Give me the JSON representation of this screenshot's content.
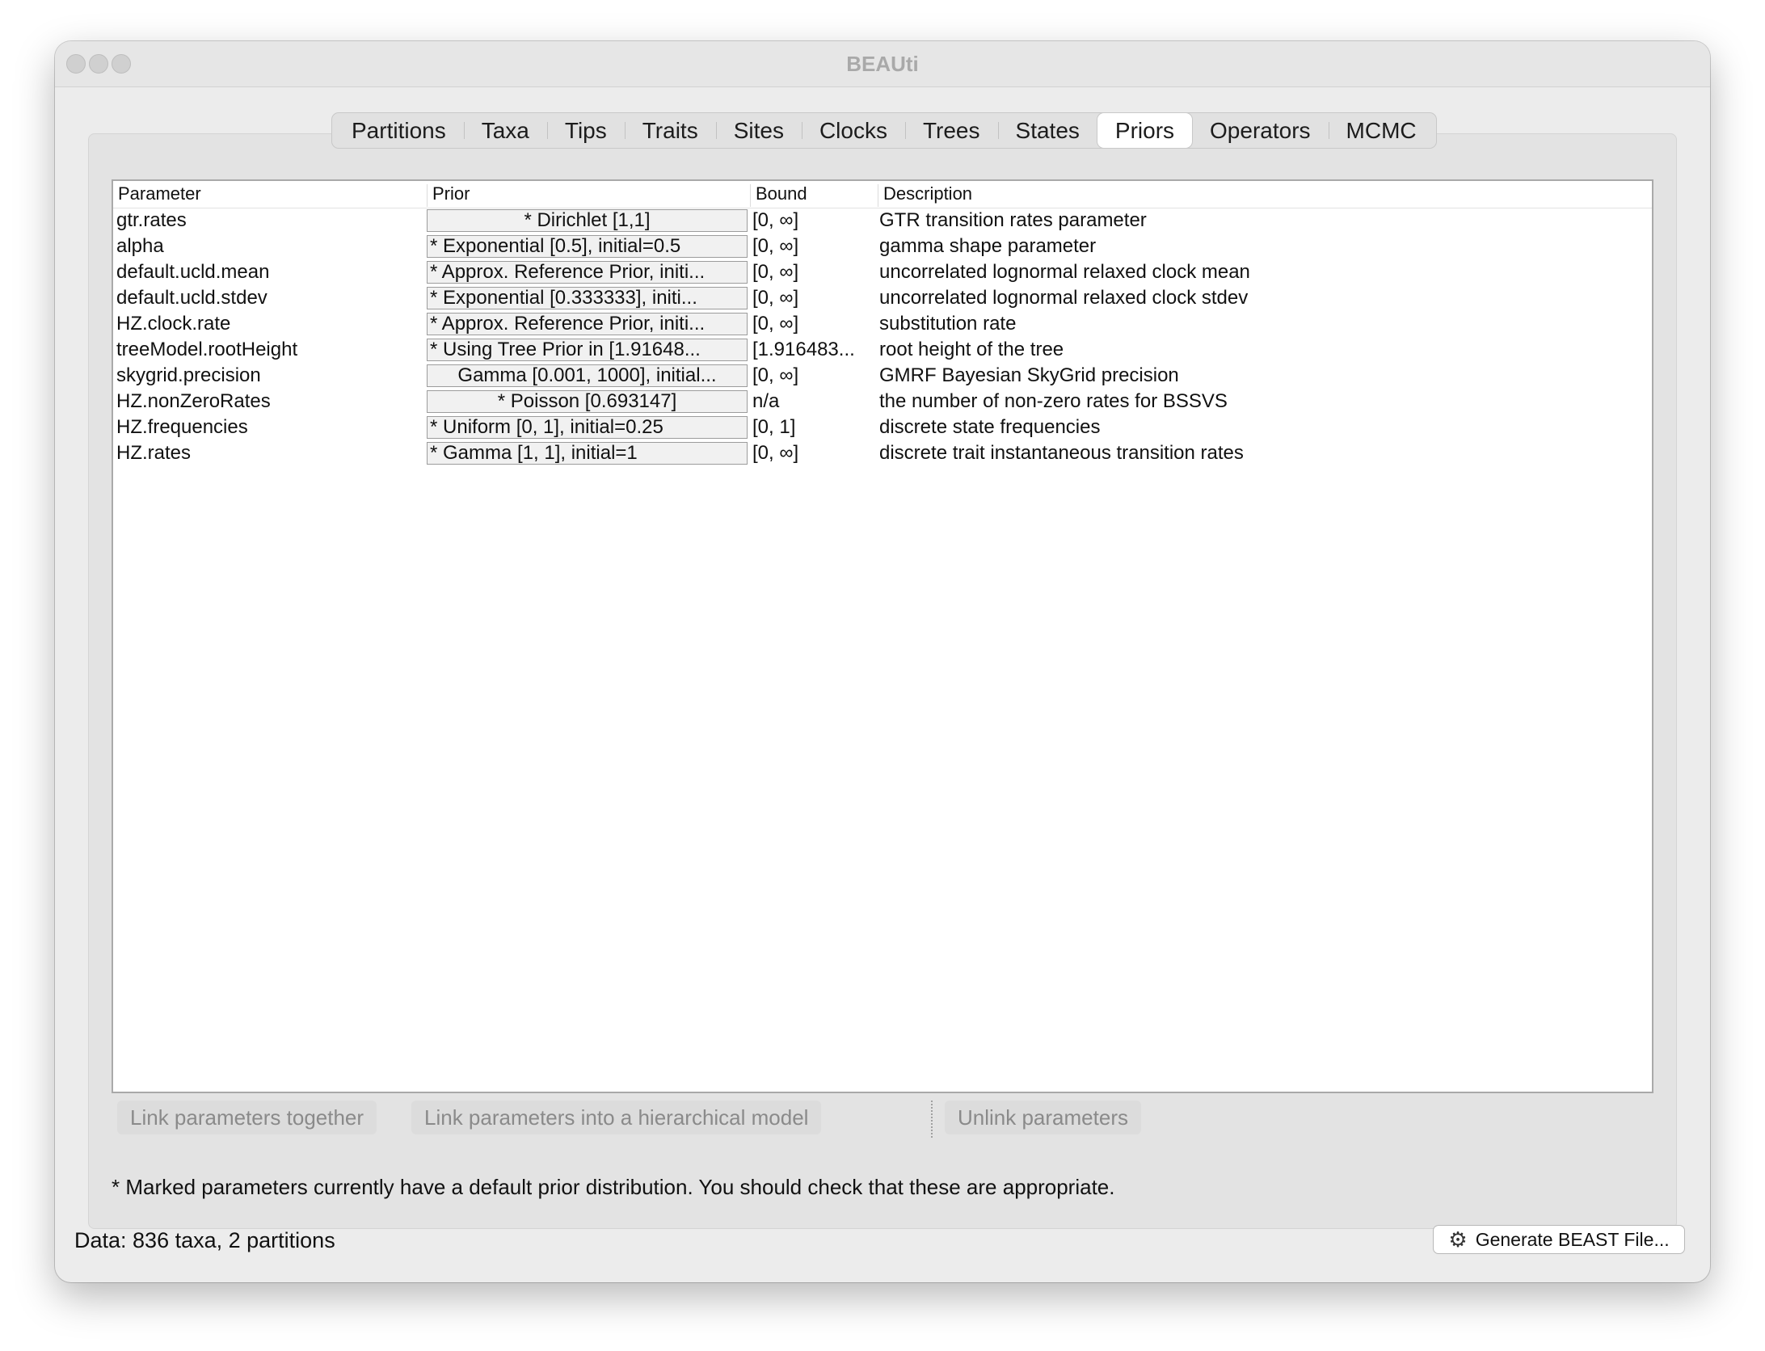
{
  "window": {
    "title": "BEAUti"
  },
  "tabs": [
    {
      "label": "Partitions"
    },
    {
      "label": "Taxa"
    },
    {
      "label": "Tips"
    },
    {
      "label": "Traits"
    },
    {
      "label": "Sites"
    },
    {
      "label": "Clocks"
    },
    {
      "label": "Trees"
    },
    {
      "label": "States"
    },
    {
      "label": "Priors",
      "active": true
    },
    {
      "label": "Operators"
    },
    {
      "label": "MCMC"
    }
  ],
  "table": {
    "headers": {
      "parameter": "Parameter",
      "prior": "Prior",
      "bound": "Bound",
      "description": "Description"
    },
    "rows": [
      {
        "parameter": "gtr.rates",
        "prior": "* Dirichlet [1,1]",
        "bound": "[0, ∞]",
        "description": "GTR transition rates parameter"
      },
      {
        "parameter": "alpha",
        "prior": "* Exponential [0.5], initial=0.5",
        "bound": "[0, ∞]",
        "description": "gamma shape parameter"
      },
      {
        "parameter": "default.ucld.mean",
        "prior": "* Approx. Reference Prior, initi...",
        "bound": "[0, ∞]",
        "description": "uncorrelated lognormal relaxed clock mean"
      },
      {
        "parameter": "default.ucld.stdev",
        "prior": "* Exponential [0.333333], initi...",
        "bound": "[0, ∞]",
        "description": "uncorrelated lognormal relaxed clock stdev"
      },
      {
        "parameter": "HZ.clock.rate",
        "prior": "* Approx. Reference Prior, initi...",
        "bound": "[0, ∞]",
        "description": "substitution rate"
      },
      {
        "parameter": "treeModel.rootHeight",
        "prior": "* Using Tree Prior in [1.91648...",
        "bound": "[1.916483...",
        "description": "root height of the tree"
      },
      {
        "parameter": "skygrid.precision",
        "prior": "Gamma [0.001, 1000], initial...",
        "bound": "[0, ∞]",
        "description": "GMRF Bayesian SkyGrid precision"
      },
      {
        "parameter": "HZ.nonZeroRates",
        "prior": "* Poisson [0.693147]",
        "bound": "n/a",
        "description": "the number of non-zero rates for BSSVS"
      },
      {
        "parameter": "HZ.frequencies",
        "prior": "* Uniform [0, 1], initial=0.25",
        "bound": "[0, 1]",
        "description": "discrete state frequencies"
      },
      {
        "parameter": "HZ.rates",
        "prior": "* Gamma [1, 1], initial=1",
        "bound": "[0, ∞]",
        "description": "discrete trait instantaneous transition rates"
      }
    ]
  },
  "buttons": {
    "link_together": "Link parameters together",
    "link_hierarchical": "Link parameters into a hierarchical model",
    "unlink": "Unlink parameters",
    "generate": "Generate BEAST File..."
  },
  "note": "* Marked parameters currently have a default prior distribution. You should check that these are appropriate.",
  "status": "Data: 836 taxa, 2 partitions",
  "icons": {
    "generate": "gear-icon"
  }
}
